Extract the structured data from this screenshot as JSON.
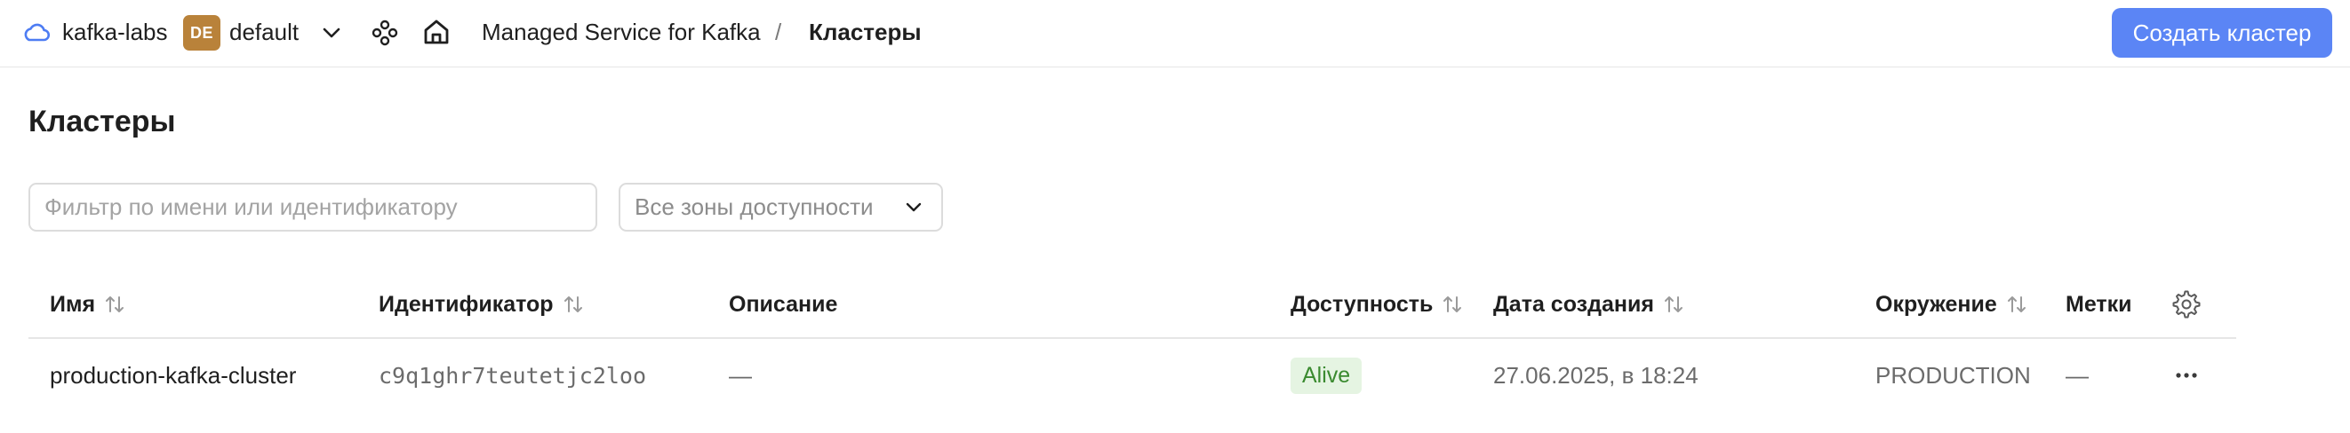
{
  "topbar": {
    "cloud_name": "kafka-labs",
    "folder_badge": "DE",
    "folder_name": "default",
    "breadcrumb": {
      "service": "Managed Service for Kafka",
      "separator": "/",
      "current": "Кластеры"
    },
    "create_button_label": "Создать кластер",
    "icons": [
      "cloud-icon",
      "chevron-down-icon",
      "services-icon",
      "home-icon"
    ]
  },
  "page": {
    "title": "Кластеры"
  },
  "filters": {
    "search_placeholder": "Фильтр по имени или идентификатору",
    "search_value": "",
    "zone_select_value": "Все зоны доступности"
  },
  "table": {
    "columns": [
      {
        "label": "Имя",
        "sortable": true
      },
      {
        "label": "Идентификатор",
        "sortable": true
      },
      {
        "label": "Описание",
        "sortable": false
      },
      {
        "label": "Доступность",
        "sortable": true
      },
      {
        "label": "Дата создания",
        "sortable": true
      },
      {
        "label": "Окружение",
        "sortable": true
      },
      {
        "label": "Метки",
        "sortable": false
      }
    ],
    "rows": [
      {
        "name": "production-kafka-cluster",
        "id": "c9q1ghr7teutetjc2loo",
        "description": "—",
        "availability": "Alive",
        "created": "27.06.2025, в 18:24",
        "environment": "PRODUCTION",
        "labels": "—"
      }
    ]
  },
  "colors": {
    "accent": "#5b85f5",
    "folder_badge": "#b9823a",
    "status_alive_bg": "#e5f4e2",
    "status_alive_text": "#3a8a2f",
    "cloud_icon": "#4d7cf3"
  }
}
